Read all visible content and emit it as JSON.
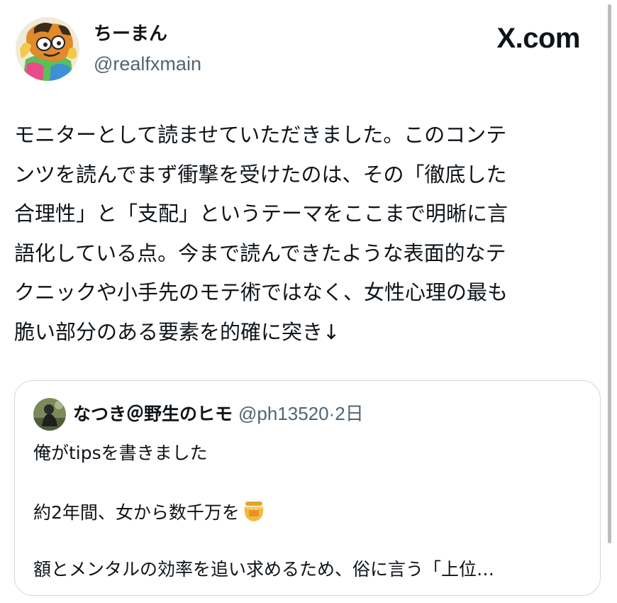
{
  "tweet": {
    "author": {
      "display_name": "ちーまん",
      "handle": "@realfxmain"
    },
    "brand": "X.com",
    "text_lines": [
      "モニターとして読ませていただきました。このコンテ",
      "ンツを読んでまず衝撃を受けたのは、その「徹底した",
      "合理性」と「支配」というテーマをここまで明晰に言",
      "語化している点。今まで読んできたような表面的なテ",
      "クニックや小手先のモテ術ではなく、女性心理の最も",
      "脆い部分のある要素を的確に突き↓"
    ]
  },
  "quote": {
    "author": {
      "display_name": "なつき＠野生のヒモ",
      "handle": "@ph13520",
      "separator": "·",
      "time": "2日"
    },
    "lines": [
      "俺がtipsを書きました",
      "約2年間、女から数千万を",
      "額とメンタルの効率を追い求めるため、俗に言う「上位…"
    ],
    "emoji": "honey-pot-icon"
  },
  "colors": {
    "text": "#0f1419",
    "secondary": "#536471",
    "border": "#cfd9de"
  }
}
